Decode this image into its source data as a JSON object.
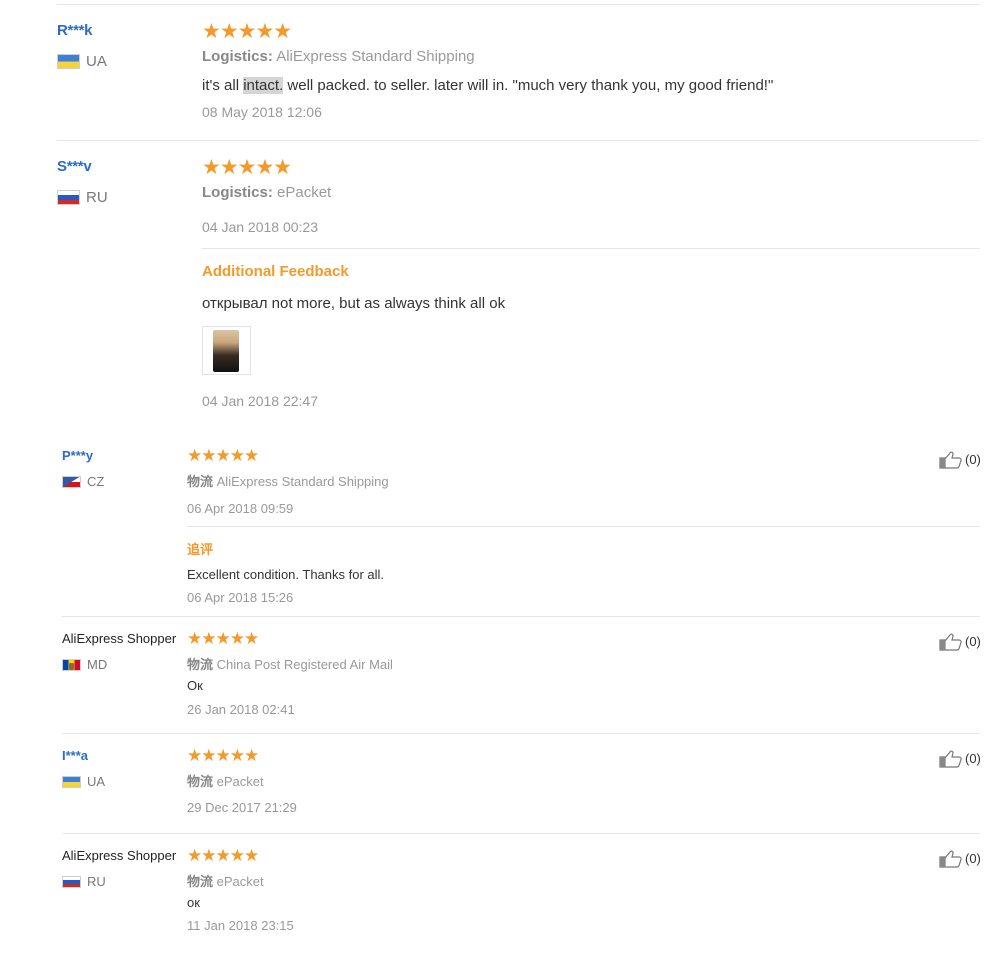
{
  "colors": {
    "star": "#f39a2b",
    "name_link": "#2b6cc7",
    "additional_label": "#f39a2b"
  },
  "icons": {
    "rating": "star-icon",
    "helpful": "thumbs-up-icon"
  },
  "reviews": [
    {
      "name": "R***k",
      "country": "UA",
      "rating": 5,
      "logistics_label": "Logistics:",
      "logistics": "AliExpress Standard Shipping",
      "text_before": "it's all ",
      "text_highlight": "intact.",
      "text_after": " well packed. to seller. later will in. \"much very thank you, my good friend!\"",
      "date": "08 May 2018 12:06"
    },
    {
      "name": "S***v",
      "country": "RU",
      "rating": 5,
      "logistics_label": "Logistics:",
      "logistics": "ePacket",
      "date": "04 Jan 2018 00:23",
      "additional_label": "Additional Feedback",
      "additional_text": "открывал not more, but as always think all ok",
      "additional_date": "04 Jan 2018 22:47"
    },
    {
      "name": "P***y",
      "country": "CZ",
      "rating": 5,
      "logistics_label": "物流",
      "logistics": "AliExpress Standard Shipping",
      "date": "06 Apr 2018 09:59",
      "additional_label": "追评",
      "additional_text": "Excellent condition. Thanks for all.",
      "additional_date": "06 Apr 2018 15:26",
      "likes": "(0)"
    },
    {
      "name": "AliExpress Shopper",
      "country": "MD",
      "rating": 5,
      "logistics_label": "物流",
      "logistics": "China Post Registered Air Mail",
      "text": "Ок",
      "date": "26 Jan 2018 02:41",
      "likes": "(0)"
    },
    {
      "name": "I***a",
      "country": "UA",
      "rating": 5,
      "logistics_label": "物流",
      "logistics": "ePacket",
      "date": "29 Dec 2017 21:29",
      "likes": "(0)"
    },
    {
      "name": "AliExpress Shopper",
      "country": "RU",
      "rating": 5,
      "logistics_label": "物流",
      "logistics": "ePacket",
      "text": "ок",
      "date": "11 Jan 2018 23:15",
      "likes": "(0)"
    }
  ]
}
